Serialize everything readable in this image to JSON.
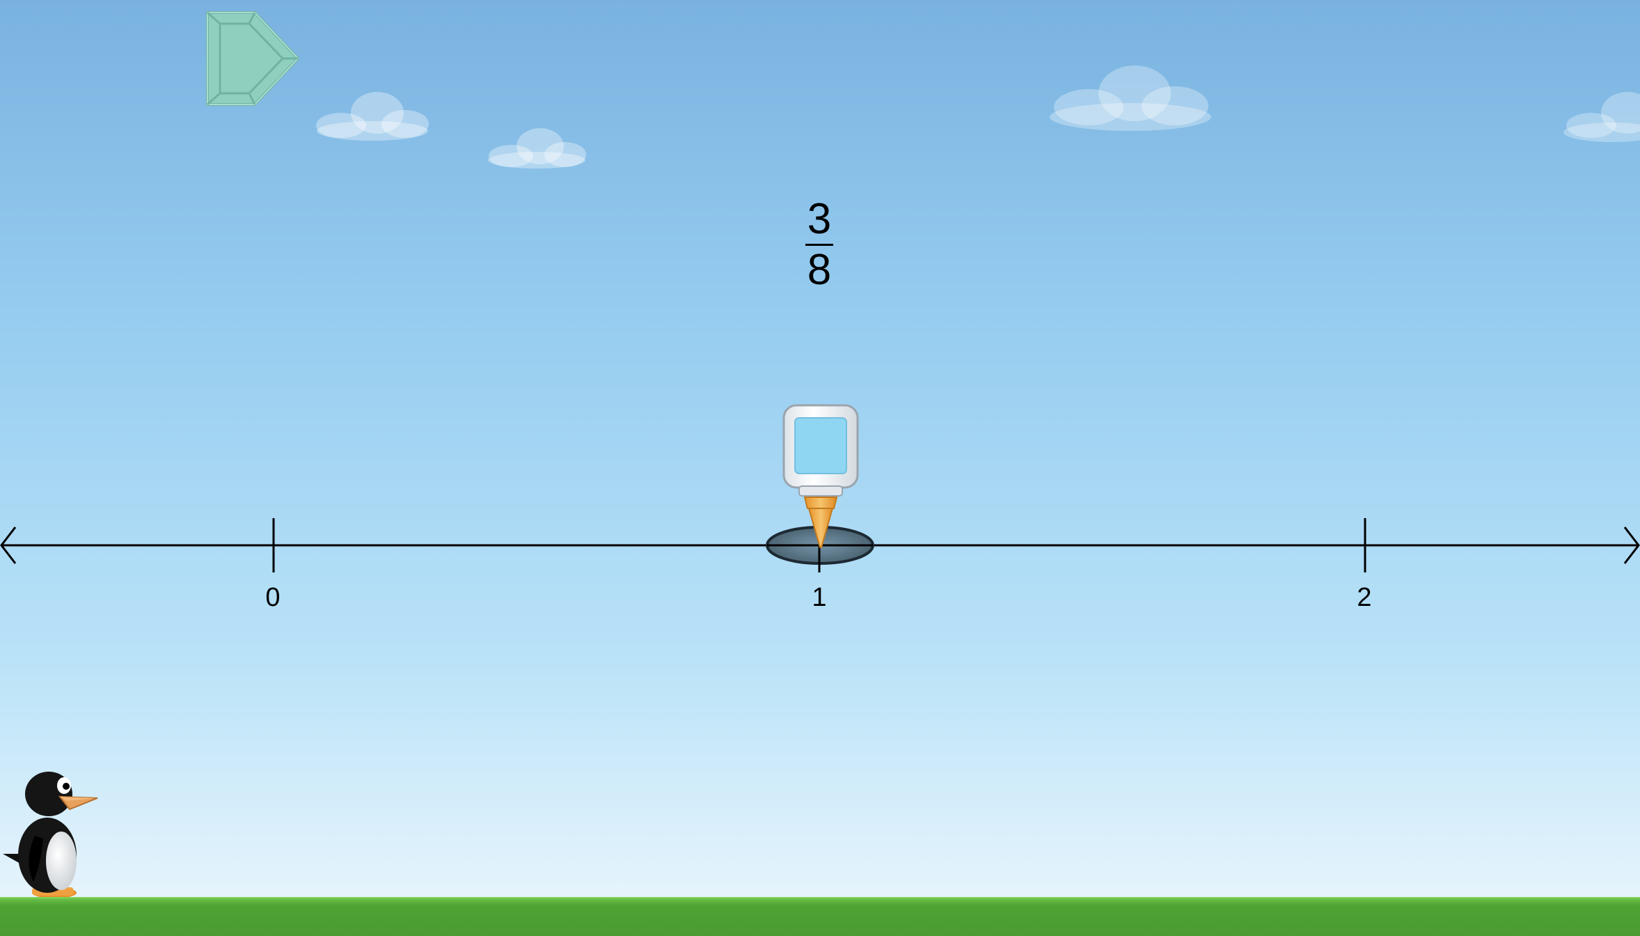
{
  "problem": {
    "fraction": {
      "numerator": "3",
      "denominator": "8"
    }
  },
  "number_line": {
    "min": 0,
    "max": 2,
    "tick_labels": [
      "0",
      "1",
      "2"
    ]
  },
  "glue_marker_value": 1,
  "icons": {
    "go_button": "play-arrow-icon",
    "marker": "glue-bottle-icon",
    "character": "penguin",
    "clouds": "cloud-icon"
  },
  "colors": {
    "sky_top": "#79b2e0",
    "sky_bottom": "#eaf6fd",
    "ground": "#4fa334",
    "go_button": "#8fcfbe",
    "glue_window": "#8fd6f2",
    "glue_nozzle": "#f0a63a"
  }
}
